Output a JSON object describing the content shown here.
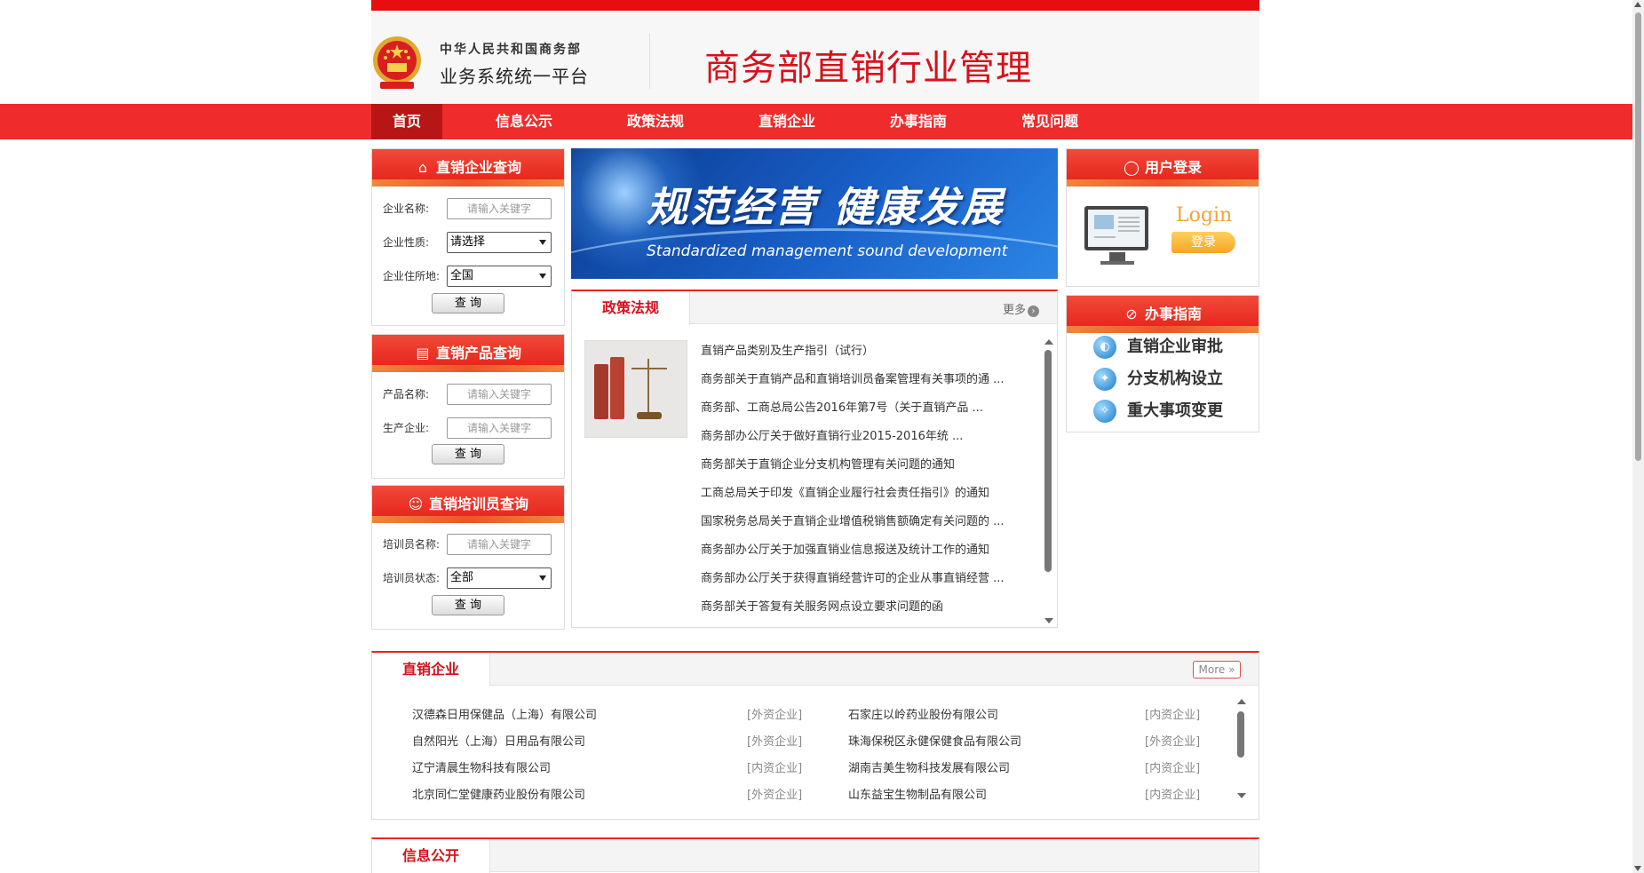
{
  "header": {
    "org_line1": "中华人民共和国商务部",
    "org_line2": "业务系统统一平台",
    "site_title": "商务部直销行业管理"
  },
  "nav": {
    "items": [
      {
        "label": "首页",
        "active": true
      },
      {
        "label": "信息公示"
      },
      {
        "label": "政策法规"
      },
      {
        "label": "直销企业"
      },
      {
        "label": "办事指南"
      },
      {
        "label": "常见问题"
      }
    ]
  },
  "enterprise_query": {
    "title": "直销企业查询",
    "name_label": "企业名称:",
    "name_placeholder": "请输入关键字",
    "nature_label": "企业性质:",
    "nature_value": "请选择",
    "location_label": "企业住所地:",
    "location_value": "全国",
    "query_label": "查 询"
  },
  "product_query": {
    "title": "直销产品查询",
    "product_label": "产品名称:",
    "product_placeholder": "请输入关键字",
    "producer_label": "生产企业:",
    "producer_placeholder": "请输入关键字",
    "query_label": "查 询"
  },
  "trainer_query": {
    "title": "直销培训员查询",
    "name_label": "培训员名称:",
    "name_placeholder": "请输入关键字",
    "status_label": "培训员状态:",
    "status_value": "全部",
    "query_label": "查 询"
  },
  "banner": {
    "title": "规范经营  健康发展",
    "subtitle": "Standardized management     sound development"
  },
  "policy": {
    "tab": "政策法规",
    "more": "更多",
    "items": [
      "直销产品类别及生产指引（试行）",
      "商务部关于直销产品和直销培训员备案管理有关事项的通 ...",
      "商务部、工商总局公告2016年第7号（关于直销产品 ...",
      "商务部办公厅关于做好直销行业2015-2016年统 ...",
      "商务部关于直销企业分支机构管理有关问题的通知",
      "工商总局关于印发《直销企业履行社会责任指引》的通知",
      "国家税务总局关于直销企业增值税销售额确定有关问题的 ...",
      "商务部办公厅关于加强直销业信息报送及统计工作的通知",
      "商务部办公厅关于获得直销经营许可的企业从事直销经营 ...",
      "商务部关于答复有关服务网点设立要求问题的函"
    ]
  },
  "login": {
    "title": "用户登录",
    "login_text": "Login",
    "button": "登录"
  },
  "guide": {
    "title": "办事指南",
    "items": [
      "直销企业审批",
      "分支机构设立",
      "重大事项变更"
    ]
  },
  "enterprises": {
    "tab": "直销企业",
    "more": "More",
    "rows": [
      {
        "left_name": "汉德森日用保健品（上海）有限公司",
        "left_type": "[外资企业]",
        "right_name": "石家庄以岭药业股份有限公司",
        "right_type": "[内资企业]"
      },
      {
        "left_name": "自然阳光（上海）日用品有限公司",
        "left_type": "[外资企业]",
        "right_name": "珠海保税区永健保健食品有限公司",
        "right_type": "[外资企业]"
      },
      {
        "left_name": "辽宁清晨生物科技有限公司",
        "left_type": "[内资企业]",
        "right_name": "湖南吉美生物科技发展有限公司",
        "right_type": "[内资企业]"
      },
      {
        "left_name": "北京同仁堂健康药业股份有限公司",
        "left_type": "[外资企业]",
        "right_name": "山东益宝生物制品有限公司",
        "right_type": "[内资企业]"
      }
    ]
  },
  "info_public": {
    "tab": "信息公开"
  },
  "colors": {
    "brand_red": "#e60e0e",
    "nav_red": "#ef2b2b",
    "nav_active": "#b81616",
    "title_red": "#d7111b"
  },
  "icons": {
    "emblem": "national-emblem-icon",
    "enterprise": "building-search-icon",
    "product": "document-search-icon",
    "trainer": "person-icon",
    "user": "user-icon",
    "guide": "compass-icon"
  }
}
